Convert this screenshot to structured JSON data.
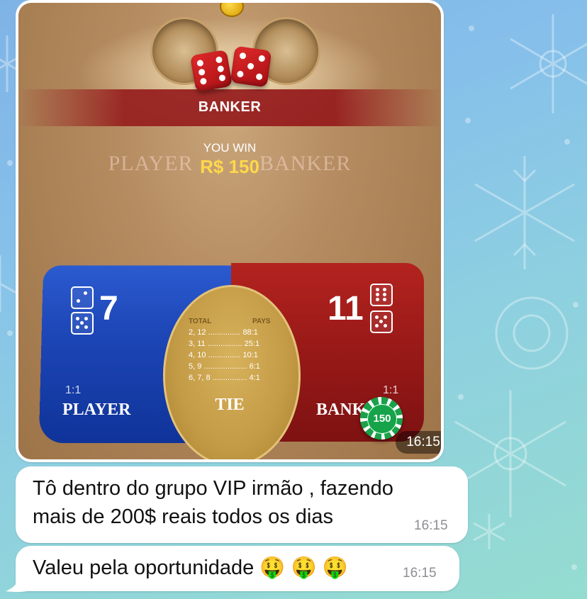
{
  "photo": {
    "banner_text": "BANKER",
    "you_win": "YOU WIN",
    "amount": "R$ 150",
    "bg_label_player": "PLAYER",
    "bg_label_banker": "BANKER",
    "player": {
      "score": "7",
      "ratio": "1:1",
      "label": "PLAYER"
    },
    "banker": {
      "score": "11",
      "ratio": "1:1",
      "label": "BANKER"
    },
    "tie": {
      "label": "TIE",
      "header_total": "TOTAL",
      "header_pays": "PAYS",
      "rows": [
        {
          "total": "2, 12",
          "pays": "88:1"
        },
        {
          "total": "3, 11",
          "pays": "25:1"
        },
        {
          "total": "4, 10",
          "pays": "10:1"
        },
        {
          "total": "5, 9",
          "pays": "6:1"
        },
        {
          "total": "6, 7, 8",
          "pays": "4:1"
        }
      ]
    },
    "chip_value": "150",
    "timestamp": "16:15"
  },
  "messages": [
    {
      "line1": "Tô dentro do grupo VIP irmão , fazendo",
      "line2": "mais de 200$ reais todos os dias",
      "time": "16:15"
    },
    {
      "text": "Valeu pela oportunidade",
      "emoji": "🤑 🤑 🤑",
      "time": "16:15"
    }
  ],
  "colors": {
    "player_blue": "#1d46b6",
    "banker_red": "#9a1a18",
    "tie_gold": "#c39a45",
    "win_yellow": "#ffd84a",
    "chip_green": "#16a34a"
  }
}
